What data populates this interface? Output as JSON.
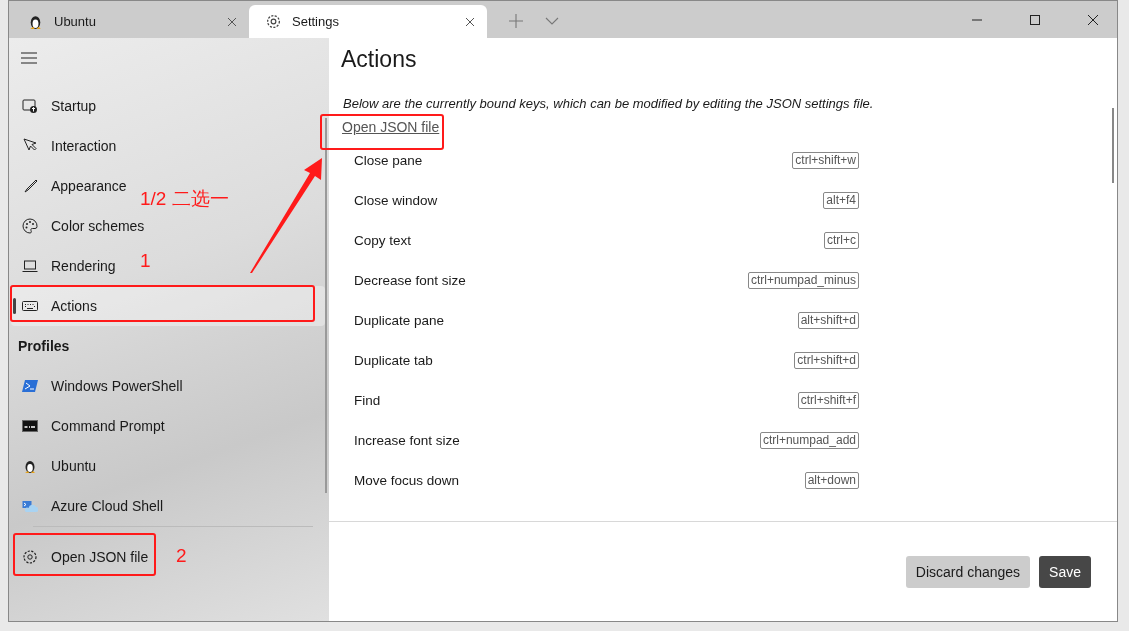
{
  "tabs": [
    {
      "label": "Ubuntu",
      "kind": "penguin",
      "selected": false
    },
    {
      "label": "Settings",
      "kind": "gear",
      "selected": true
    }
  ],
  "sidebar": {
    "items": [
      {
        "label": "Startup",
        "kind": "startup",
        "selected": false
      },
      {
        "label": "Interaction",
        "kind": "pointer",
        "selected": false
      },
      {
        "label": "Appearance",
        "kind": "brush",
        "selected": false
      },
      {
        "label": "Color schemes",
        "kind": "palette",
        "selected": false
      },
      {
        "label": "Rendering",
        "kind": "laptop",
        "selected": false
      },
      {
        "label": "Actions",
        "kind": "keyboard",
        "selected": true
      }
    ],
    "profiles_header": "Profiles",
    "profiles": [
      {
        "label": "Windows PowerShell",
        "kind": "powershell",
        "selected": false
      },
      {
        "label": "Command Prompt",
        "kind": "cmd",
        "selected": false
      },
      {
        "label": "Ubuntu",
        "kind": "penguin",
        "selected": false
      },
      {
        "label": "Azure Cloud Shell",
        "kind": "azure",
        "selected": false
      }
    ],
    "footer_item": {
      "label": "Open JSON file",
      "kind": "gear"
    }
  },
  "content": {
    "title": "Actions",
    "description": "Below are the currently bound keys, which can be modified by editing the JSON settings file.",
    "link": "Open JSON file",
    "bindings": [
      {
        "action": "Close pane",
        "keys": "ctrl+shift+w"
      },
      {
        "action": "Close window",
        "keys": "alt+f4"
      },
      {
        "action": "Copy text",
        "keys": "ctrl+c"
      },
      {
        "action": "Decrease font size",
        "keys": "ctrl+numpad_minus"
      },
      {
        "action": "Duplicate pane",
        "keys": "alt+shift+d"
      },
      {
        "action": "Duplicate tab",
        "keys": "ctrl+shift+d"
      },
      {
        "action": "Find",
        "keys": "ctrl+shift+f"
      },
      {
        "action": "Increase font size",
        "keys": "ctrl+numpad_add"
      },
      {
        "action": "Move focus down",
        "keys": "alt+down"
      }
    ]
  },
  "buttons": [
    {
      "label": "Discard changes",
      "kind": "secondary"
    },
    {
      "label": "Save",
      "kind": "primary"
    }
  ],
  "annotations": [
    "1/2 二选一",
    "1",
    "2"
  ]
}
